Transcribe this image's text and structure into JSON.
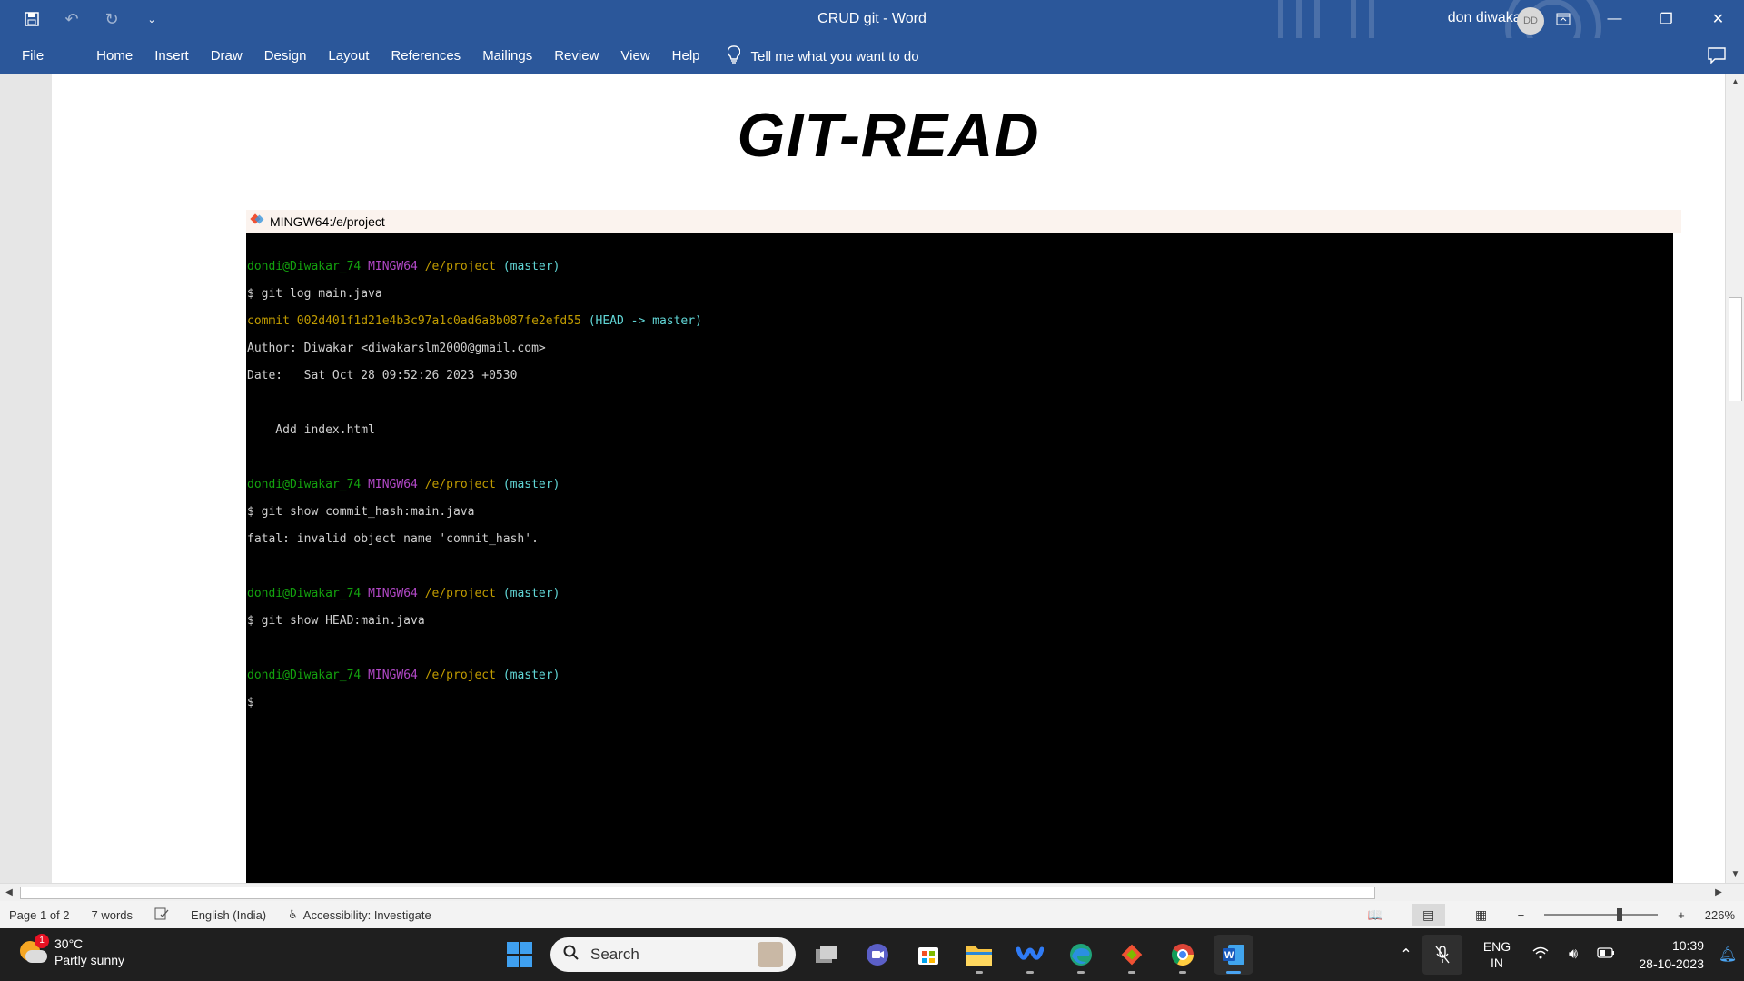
{
  "titlebar": {
    "doc_title": "CRUD git  -  Word",
    "user_name": "don diwakar",
    "user_initials": "DD",
    "qat_icons": [
      "save-icon",
      "undo-icon",
      "redo-icon",
      "customize-qat-icon"
    ],
    "window_buttons": [
      "ribbon-display-icon",
      "minimize-icon",
      "restore-icon",
      "close-icon"
    ]
  },
  "ribbon": {
    "tabs": [
      "File",
      "Home",
      "Insert",
      "Draw",
      "Design",
      "Layout",
      "References",
      "Mailings",
      "Review",
      "View",
      "Help"
    ],
    "tell_me": "Tell me what you want to do"
  },
  "document": {
    "heading": "GIT-READ",
    "terminal_title": "MINGW64:/e/project",
    "terminal": {
      "prompt_user": "dondi@Diwakar_74",
      "prompt_env": "MINGW64",
      "prompt_path": "/e/project",
      "prompt_branch": "(master)",
      "cmd1": "$ git log main.java",
      "commit_hash": "commit 002d401f1d21e4b3c97a1c0ad6a8b087fe2efd55",
      "commit_head": "(HEAD -> master)",
      "author": "Author: Diwakar <diwakarslm2000@gmail.com>",
      "date": "Date:   Sat Oct 28 09:52:26 2023 +0530",
      "message": "    Add index.html",
      "cmd2": "$ git show commit_hash:main.java",
      "fatal": "fatal: invalid object name 'commit_hash'.",
      "cmd3": "$ git show HEAD:main.java",
      "cursor": "$"
    }
  },
  "statusbar": {
    "page": "Page 1 of 2",
    "words": "7 words",
    "language": "English (India)",
    "accessibility": "Accessibility: Investigate",
    "zoom": "226%"
  },
  "taskbar": {
    "temperature": "30°C",
    "weather": "Partly sunny",
    "weather_badge": "1",
    "search_label": "Search",
    "lang_line1": "ENG",
    "lang_line2": "IN",
    "time": "10:39",
    "date": "28-10-2023"
  },
  "colors": {
    "word_blue": "#2b579a",
    "term_green": "#13a10e",
    "term_magenta": "#b148c6",
    "term_yellow": "#c19c00",
    "term_cyan": "#61d6d6"
  }
}
